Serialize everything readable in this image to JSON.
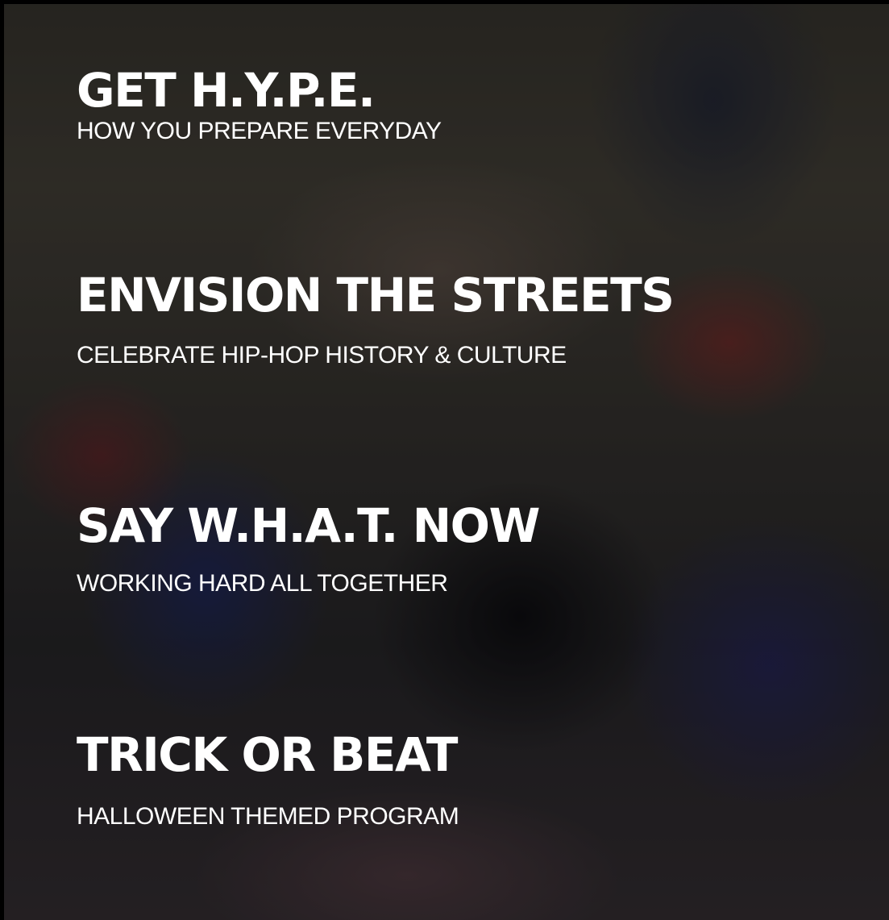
{
  "programs": [
    {
      "title": "GET H.Y.P.E.",
      "subtitle": "HOW YOU PREPARE EVERYDAY"
    },
    {
      "title": "ENVISION THE STREETS",
      "subtitle": "CELEBRATE HIP-HOP HISTORY & CULTURE"
    },
    {
      "title": "SAY W.H.A.T. NOW",
      "subtitle": "WORKING HARD ALL TOGETHER"
    },
    {
      "title": "TRICK OR BEAT",
      "subtitle": "HALLOWEEN THEMED PROGRAM"
    }
  ],
  "colors": {
    "text": "#ffffff",
    "background": "#000000"
  }
}
